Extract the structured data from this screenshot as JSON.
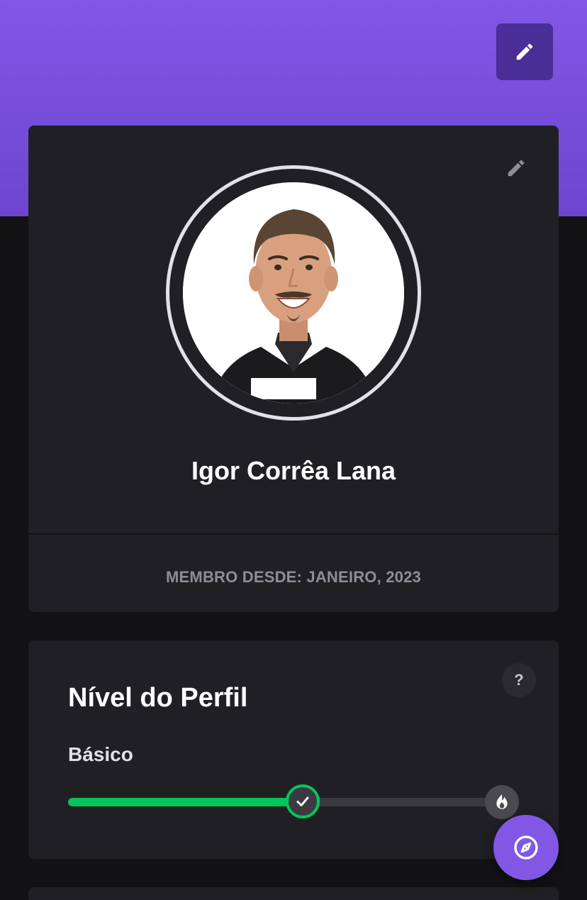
{
  "banner": {
    "edit_icon": "pencil-icon",
    "gradient_colors": [
      "#8257e5",
      "#6d45cf"
    ]
  },
  "profile": {
    "name": "Igor Corrêa Lana",
    "member_since": "MEMBRO DESDE: JANEIRO, 2023",
    "edit_icon": "pencil-icon",
    "avatar_icon": "profile-photo"
  },
  "level": {
    "title": "Nível do Perfil",
    "current_level": "Básico",
    "help_label": "?",
    "progress": 0.52,
    "progress_color": "#04c45c",
    "milestone_icons": [
      "check-icon",
      "fire-icon"
    ]
  },
  "fab": {
    "icon": "compass-icon",
    "color": "#8257e5"
  }
}
